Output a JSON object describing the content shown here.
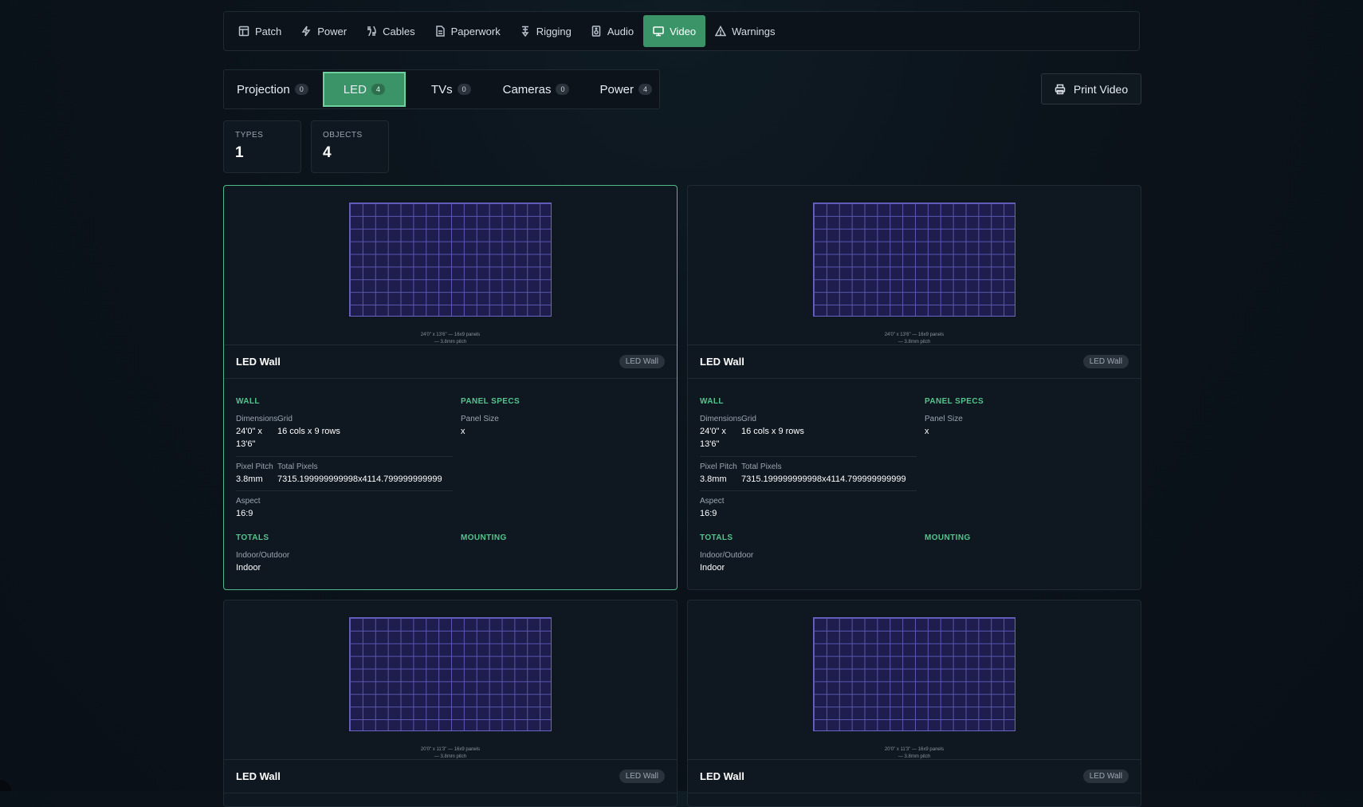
{
  "nav": {
    "items": [
      {
        "label": "Patch",
        "icon": "table-icon"
      },
      {
        "label": "Power",
        "icon": "bolt-icon"
      },
      {
        "label": "Cables",
        "icon": "cable-icon"
      },
      {
        "label": "Paperwork",
        "icon": "document-icon"
      },
      {
        "label": "Rigging",
        "icon": "rigging-icon"
      },
      {
        "label": "Audio",
        "icon": "speaker-icon"
      },
      {
        "label": "Video",
        "icon": "monitor-icon",
        "active": true
      },
      {
        "label": "Warnings",
        "icon": "warning-icon"
      }
    ]
  },
  "subtabs": [
    {
      "label": "Projection",
      "count": "0"
    },
    {
      "label": "LED",
      "count": "4",
      "active": true
    },
    {
      "label": "TVs",
      "count": "0"
    },
    {
      "label": "Cameras",
      "count": "0"
    },
    {
      "label": "Power",
      "count": "4"
    }
  ],
  "print_label": "Print Video",
  "stats": {
    "types": {
      "label": "TYPES",
      "value": "1"
    },
    "objects": {
      "label": "OBJECTS",
      "value": "4"
    }
  },
  "cards": [
    {
      "caption_line1": "24'0\" x 13'6\" — 16x9 panels",
      "caption_line2": "— 3.8mm pitch",
      "title": "LED Wall",
      "badge": "LED Wall",
      "wall_heading": "WALL",
      "panel_heading": "PANEL SPECS",
      "dimensions_label": "Dimensions",
      "grid_label": "Grid",
      "dimensions_line1": "24'0\" x",
      "dimensions_line2": "13'6\"",
      "grid_value": "16 cols x 9 rows",
      "panel_size_label": "Panel Size",
      "panel_size_value": "x",
      "pitch_label": "Pixel Pitch",
      "pitch_value": "3.8mm",
      "total_pixels_label": "Total Pixels",
      "total_pixels_value": "7315.199999999998x4114.799999999999",
      "aspect_label": "Aspect",
      "aspect_value": "16:9",
      "totals_heading": "TOTALS",
      "mounting_heading": "MOUNTING",
      "indoor_label": "Indoor/Outdoor",
      "indoor_value": "Indoor"
    },
    {
      "caption_line1": "24'0\" x 13'6\" — 16x9 panels",
      "caption_line2": "— 3.8mm pitch",
      "title": "LED Wall",
      "badge": "LED Wall",
      "wall_heading": "WALL",
      "panel_heading": "PANEL SPECS",
      "dimensions_label": "Dimensions",
      "grid_label": "Grid",
      "dimensions_line1": "24'0\" x",
      "dimensions_line2": "13'6\"",
      "grid_value": "16 cols x 9 rows",
      "panel_size_label": "Panel Size",
      "panel_size_value": "x",
      "pitch_label": "Pixel Pitch",
      "pitch_value": "3.8mm",
      "total_pixels_label": "Total Pixels",
      "total_pixels_value": "7315.199999999998x4114.799999999999",
      "aspect_label": "Aspect",
      "aspect_value": "16:9",
      "totals_heading": "TOTALS",
      "mounting_heading": "MOUNTING",
      "indoor_label": "Indoor/Outdoor",
      "indoor_value": "Indoor"
    },
    {
      "caption_line1": "20'0\" x 11'3\" — 16x9 panels",
      "caption_line2": "— 3.8mm pitch",
      "title": "LED Wall",
      "badge": "LED Wall"
    },
    {
      "caption_line1": "20'0\" x 11'3\" — 16x9 panels",
      "caption_line2": "— 3.8mm pitch",
      "title": "LED Wall",
      "badge": "LED Wall"
    }
  ]
}
